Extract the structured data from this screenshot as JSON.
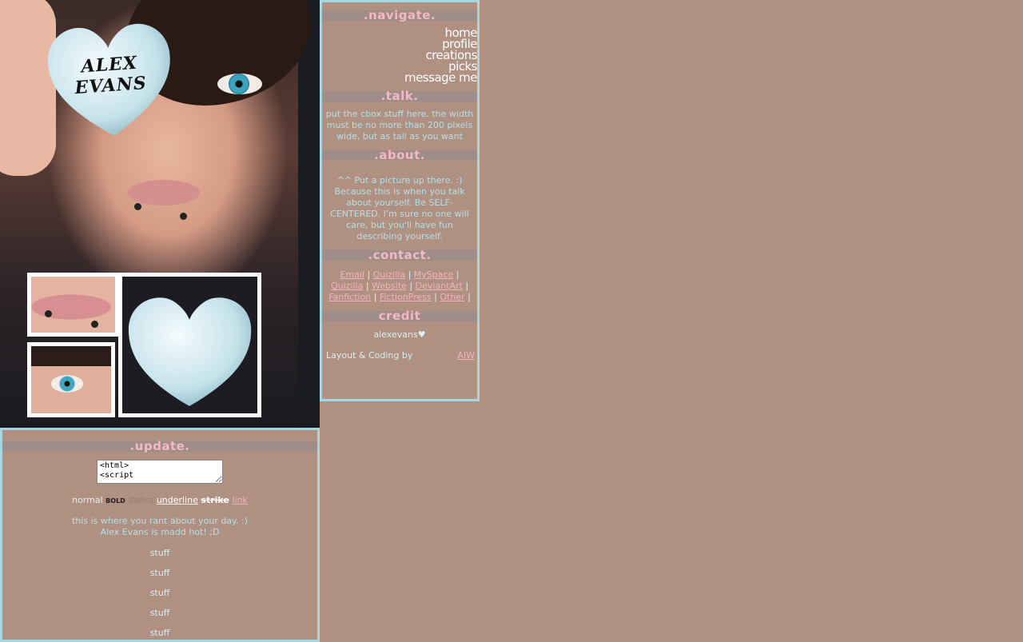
{
  "header": {
    "heart_text": "ALEX EVANS"
  },
  "nav": {
    "title": ".navigate.",
    "links": [
      "home",
      "profile",
      "creations",
      "picks",
      "message me"
    ]
  },
  "talk": {
    "title": ".talk.",
    "text": "put the cbox stuff here. the width must be no more than 200 pixels wide, but as tall as you want"
  },
  "about": {
    "title": ".about.",
    "text": "^^ Put a picture up there. :) Because this is when you talk about yourself. Be SELF-CENTERED. I'm sure no one will care, but you'll have fun describing yourself."
  },
  "contact": {
    "title": ".contact.",
    "links": [
      "Email",
      "Quizilla",
      "MySpace",
      "Quizilla",
      "Website",
      "DeviantArt",
      "Fanfiction",
      "FictionPress",
      "Other"
    ],
    "separator": "|"
  },
  "credit": {
    "title": "credit",
    "name": "alexevans♥",
    "layout_label": "Layout & Coding by",
    "author_link": "AIW"
  },
  "update": {
    "title": ".update.",
    "code_box_value": "<html>\n<script",
    "format_demo": {
      "normal": "normal",
      "bold": "BOLD",
      "italics": "italics",
      "underline": "underline",
      "strike": "strike",
      "link": "link"
    },
    "rant_line1": "this is where you rant about your day. :)",
    "rant_line2": "Alex Evans is madd hot! ;D",
    "stuff_items": [
      "stuff",
      "stuff",
      "stuff",
      "stuff",
      "stuff"
    ]
  },
  "colors": {
    "background": "#b09080",
    "border": "#a6d6df",
    "heading": "#f3b8c4",
    "heading_bar": "#9e8d89",
    "text_light": "#b5e0e8",
    "link": "#f2b3c0"
  }
}
